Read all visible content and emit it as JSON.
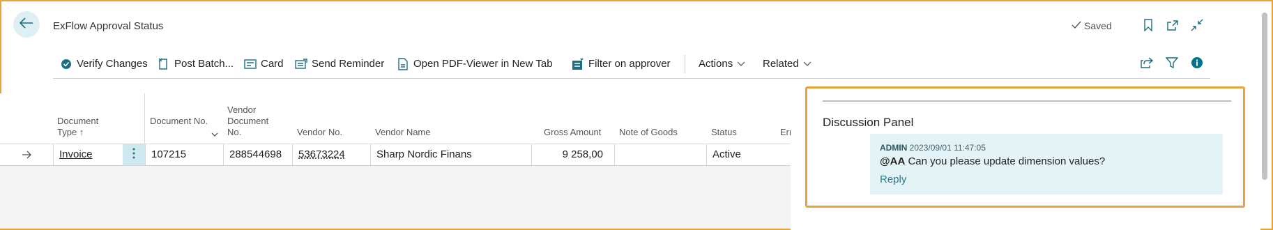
{
  "header": {
    "title": "ExFlow Approval Status",
    "saved_label": "Saved",
    "icons": [
      "back-arrow-icon",
      "bookmark-icon",
      "open-new-window-icon",
      "collapse-icon"
    ]
  },
  "toolbar": {
    "verify_changes": "Verify Changes",
    "post_batch": "Post Batch...",
    "card": "Card",
    "send_reminder": "Send Reminder",
    "open_pdf": "Open PDF-Viewer in New Tab",
    "filter_on_approver": "Filter on approver",
    "actions": "Actions",
    "related": "Related"
  },
  "table": {
    "columns": {
      "document_type_line1": "Document",
      "document_type_line2": "Type ↑",
      "document_no": "Document No.",
      "vendor_document_no_line1": "Vendor",
      "vendor_document_no_line2": "Document",
      "vendor_document_no_line3": "No.",
      "vendor_no": "Vendor No.",
      "vendor_name": "Vendor Name",
      "gross_amount": "Gross Amount",
      "note_of_goods": "Note of Goods",
      "status": "Status",
      "err": "Err"
    },
    "rows": [
      {
        "document_type": "Invoice",
        "document_no": "107215",
        "vendor_document_no": "288544698",
        "vendor_no": "53673224",
        "vendor_name": "Sharp Nordic Finans",
        "gross_amount": "9 258,00",
        "note_of_goods": "",
        "status": "Active"
      }
    ]
  },
  "discussion": {
    "title": "Discussion Panel",
    "messages": [
      {
        "author": "ADMIN",
        "timestamp": "2023/09/01 11:47:05",
        "mention": "@AA",
        "text": "Can you please update dimension values?",
        "reply_label": "Reply"
      }
    ]
  },
  "colors": {
    "accent": "#e8a33d",
    "brand_teal": "#00748c",
    "message_bg": "#e4f4f6"
  }
}
